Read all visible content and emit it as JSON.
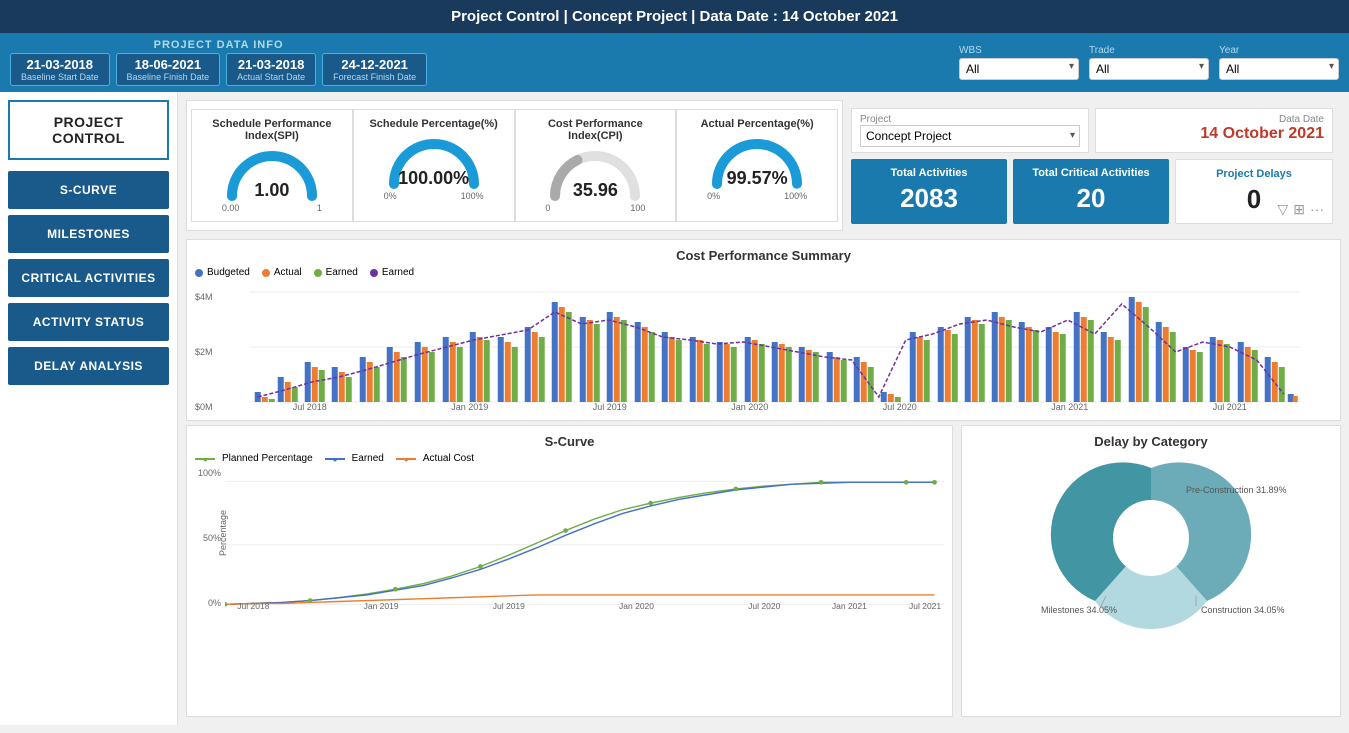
{
  "header": {
    "title": "Project Control | Concept Project | Data Date : 14 October 2021"
  },
  "dataInfo": {
    "label": "PROJECT DATA INFO",
    "dates": [
      {
        "value": "21-03-2018",
        "label": "Baseline Start Date"
      },
      {
        "value": "18-06-2021",
        "label": "Baseline Finish Date"
      },
      {
        "value": "21-03-2018",
        "label": "Actual Start Date"
      },
      {
        "value": "24-12-2021",
        "label": "Forecast Finish Date"
      }
    ],
    "filters": {
      "wbs": {
        "label": "WBS",
        "value": "All"
      },
      "trade": {
        "label": "Trade",
        "value": "All"
      },
      "year": {
        "label": "Year",
        "value": "All"
      }
    }
  },
  "sidebar": {
    "title": "PROJECT CONTROL",
    "buttons": [
      "S-CURVE",
      "MILESTONES",
      "CRITICAL ACTIVITIES",
      "ACTIVITY STATUS",
      "DELAY ANALYSIS"
    ]
  },
  "gauges": [
    {
      "title": "Schedule Performance Index(SPI)",
      "value": "1.00",
      "min": "0.00",
      "max": "1",
      "percent": 100,
      "color": "#1a9ad6"
    },
    {
      "title": "Schedule Percentage(%)",
      "value": "100.00%",
      "min": "0%",
      "max": "100%",
      "percent": 100,
      "color": "#1a9ad6"
    },
    {
      "title": "Cost Performance Index(CPI)",
      "value": "35.96",
      "min": "0",
      "max": "100",
      "percent": 36,
      "color": "#aaa"
    },
    {
      "title": "Actual Percentage(%)",
      "value": "99.57%",
      "min": "0%",
      "max": "100%",
      "percent": 99.57,
      "color": "#1a9ad6"
    }
  ],
  "project": {
    "label": "Project",
    "value": "Concept Project"
  },
  "dataDate": {
    "label": "Data Date",
    "value": "14 October 2021"
  },
  "stats": {
    "totalActivities": {
      "label": "Total Activities",
      "value": "2083"
    },
    "totalCritical": {
      "label": "Total Critical Activities",
      "value": "20"
    },
    "projectDelays": {
      "label": "Project Delays",
      "value": "0"
    }
  },
  "costChart": {
    "title": "Cost Performance Summary",
    "legend": [
      {
        "label": "Budgeted",
        "color": "#4472c4"
      },
      {
        "label": "Actual",
        "color": "#ed7d31"
      },
      {
        "label": "Earned",
        "color": "#70ad47"
      },
      {
        "label": "Earned",
        "color": "#7030a0"
      }
    ],
    "xLabels": [
      "Jul 2018",
      "Jan 2019",
      "Jul 2019",
      "Jan 2020",
      "Jul 2020",
      "Jan 2021",
      "Jul 2021"
    ],
    "yLabels": [
      "$0M",
      "$2M",
      "$4M"
    ]
  },
  "scurve": {
    "title": "S-Curve",
    "legend": [
      {
        "label": "Planned Percentage",
        "color": "#70ad47"
      },
      {
        "label": "Earned",
        "color": "#4472c4"
      },
      {
        "label": "Actual Cost",
        "color": "#ed7d31"
      }
    ],
    "xLabels": [
      "Jul 2018",
      "Jan 2019",
      "Jul 2019",
      "Jan 2020",
      "Jul 2020",
      "Jan 2021",
      "Jul 2021"
    ],
    "yLabels": [
      "0%",
      "50%",
      "100%"
    ],
    "yAxisLabel": "Percentage"
  },
  "delayChart": {
    "title": "Delay by Category",
    "segments": [
      {
        "label": "Pre-Construction 31.89%",
        "color": "#5ba3b0",
        "percent": 31.89
      },
      {
        "label": "Construction 34.05%",
        "color": "#a8d5dc",
        "percent": 34.05
      },
      {
        "label": "Milestones 34.05%",
        "color": "#2e8b9a",
        "percent": 34.05
      }
    ]
  }
}
